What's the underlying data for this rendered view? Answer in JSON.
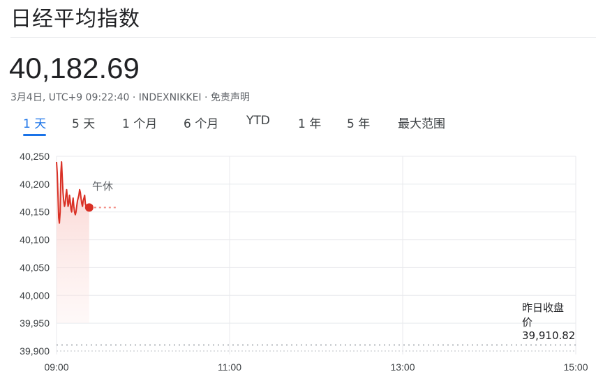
{
  "header": {
    "title": "日经平均指数",
    "price": "40,182.69",
    "meta": "3月4日, UTC+9 09:22:40 · INDEXNIKKEI · 免责声明"
  },
  "tabs": [
    {
      "label": "1 天",
      "active": true
    },
    {
      "label": "5 天",
      "active": false
    },
    {
      "label": "1 个月",
      "active": false
    },
    {
      "label": "6 个月",
      "active": false
    },
    {
      "label": "YTD",
      "active": false
    },
    {
      "label": "1 年",
      "active": false
    },
    {
      "label": "5 年",
      "active": false
    },
    {
      "label": "最大范围",
      "active": false
    }
  ],
  "colors": {
    "line": "#d93025",
    "fill_top": "#f8c9c5",
    "grid": "#e8eaed",
    "accent": "#1a73e8",
    "reference": "#9aa0a6"
  },
  "chart_data": {
    "type": "line",
    "yticks": [
      40250,
      40200,
      40150,
      40100,
      40050,
      40000,
      39950,
      39900
    ],
    "ytick_labels": [
      "40,250",
      "40,200",
      "40,150",
      "40,100",
      "40,050",
      "40,000",
      "39,950",
      "39,900"
    ],
    "ylim": [
      39900,
      40250
    ],
    "xticks": [
      "09:00",
      "11:00",
      "13:00",
      "15:00"
    ],
    "xlim": [
      "09:00",
      "15:00"
    ],
    "series": [
      {
        "x": [
          "09:00:00",
          "09:00:30",
          "09:01:00",
          "09:01:30",
          "09:02:00",
          "09:02:30",
          "09:03:00",
          "09:03:30",
          "09:04:00",
          "09:04:30",
          "09:05:00",
          "09:05:30",
          "09:06:00",
          "09:06:30",
          "09:07:00",
          "09:07:30",
          "09:08:00",
          "09:08:30",
          "09:09:00",
          "09:09:30",
          "09:10:00",
          "09:10:30",
          "09:11:00",
          "09:11:30",
          "09:12:00",
          "09:12:30",
          "09:13:00",
          "09:13:30",
          "09:14:00",
          "09:14:30",
          "09:15:00",
          "09:15:30",
          "09:16:00",
          "09:16:30",
          "09:17:00",
          "09:17:30",
          "09:18:00",
          "09:18:30",
          "09:19:00",
          "09:19:30",
          "09:20:00",
          "09:20:30",
          "09:21:00",
          "09:22:40"
        ],
        "y": [
          40240,
          40220,
          40180,
          40140,
          40130,
          40150,
          40220,
          40240,
          40210,
          40185,
          40170,
          40160,
          40165,
          40180,
          40190,
          40175,
          40160,
          40165,
          40180,
          40170,
          40155,
          40150,
          40165,
          40175,
          40160,
          40150,
          40145,
          40150,
          40160,
          40170,
          40175,
          40180,
          40190,
          40185,
          40175,
          40165,
          40160,
          40170,
          40175,
          40180,
          40165,
          40160,
          40158,
          40158
        ]
      }
    ],
    "last_point": {
      "x": "09:22:40",
      "y": 40158
    },
    "annotation": "午休",
    "previous_close": {
      "label": "昨日收盘价",
      "value": 39910.82,
      "value_label": "39,910.82"
    }
  }
}
